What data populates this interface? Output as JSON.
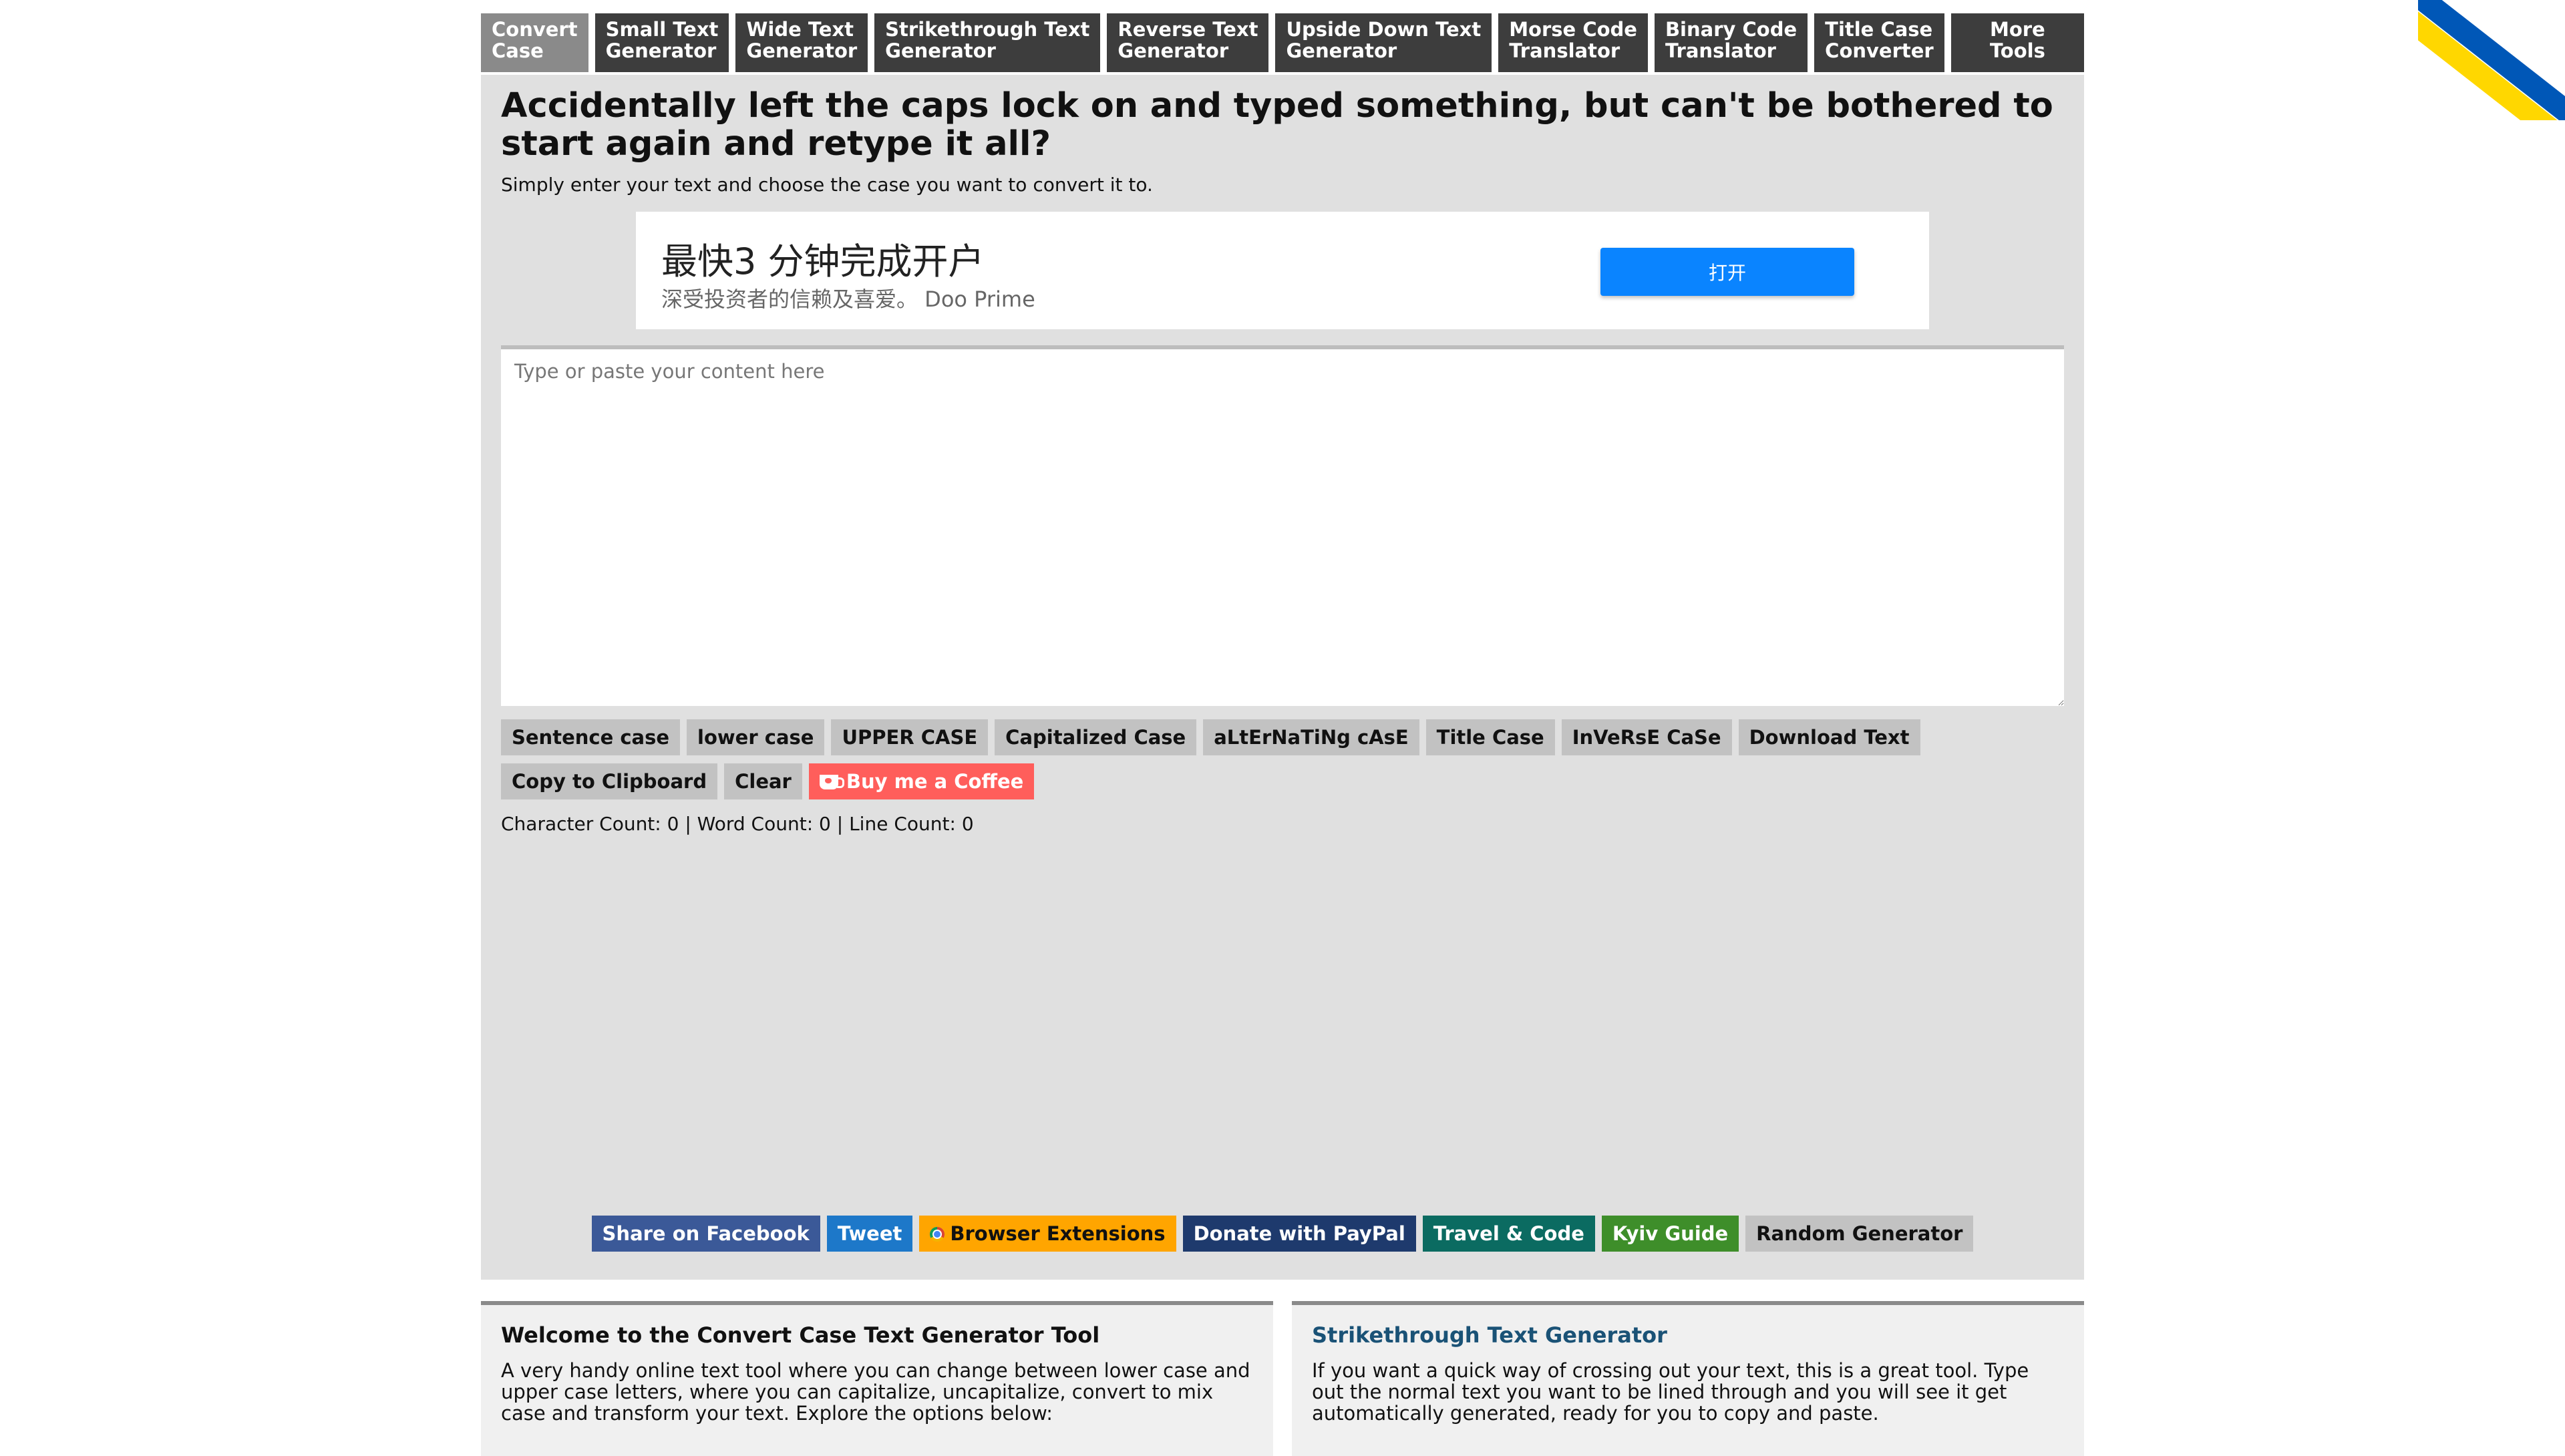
{
  "nav": [
    {
      "line1": "Convert",
      "line2": "Case",
      "active": true
    },
    {
      "line1": "Small Text",
      "line2": "Generator"
    },
    {
      "line1": "Wide Text",
      "line2": "Generator"
    },
    {
      "line1": "Strikethrough Text",
      "line2": "Generator"
    },
    {
      "line1": "Reverse Text",
      "line2": "Generator"
    },
    {
      "line1": "Upside Down Text",
      "line2": "Generator"
    },
    {
      "line1": "Morse Code",
      "line2": "Translator"
    },
    {
      "line1": "Binary Code",
      "line2": "Translator"
    },
    {
      "line1": "Title Case",
      "line2": "Converter"
    },
    {
      "line1": "More",
      "line2": "Tools"
    }
  ],
  "main": {
    "heading": "Accidentally left the caps lock on and typed something, but can't be bothered to start again and retype it all?",
    "subtitle": "Simply enter your text and choose the case you want to convert it to.",
    "textarea_placeholder": "Type or paste your content here",
    "counts": "Character Count: 0 | Word Count: 0 | Line Count: 0"
  },
  "ad": {
    "title": "最快3 分钟完成开户",
    "desc": "深受投资者的信赖及喜爱。 Doo Prime",
    "button": "打开"
  },
  "buttons": {
    "sentence": "Sentence case",
    "lower": "lower case",
    "upper": "UPPER CASE",
    "capitalized": "Capitalized Case",
    "alternating": "aLtErNaTiNg cAsE",
    "title": "Title Case",
    "inverse": "InVeRsE CaSe",
    "download": "Download Text",
    "copy": "Copy to Clipboard",
    "clear": "Clear",
    "coffee": "Buy me a Coffee"
  },
  "share": {
    "facebook": "Share on Facebook",
    "tweet": "Tweet",
    "extensions": "Browser Extensions",
    "paypal": "Donate with PayPal",
    "travel": "Travel & Code",
    "kyiv": "Kyiv Guide",
    "random": "Random Generator"
  },
  "cards": {
    "welcome": {
      "title": "Welcome to the Convert Case Text Generator Tool",
      "text": "A very handy online text tool where you can change between lower case and upper case letters, where you can capitalize, uncapitalize, convert to mix case and transform your text. Explore the options below:"
    },
    "strike": {
      "title": "Strikethrough Text Generator",
      "text": "If you want a quick way of crossing out your text, this is a great tool. Type out the normal text you want to be lined through and you will see it get automatically generated, ready for you to copy and paste."
    }
  },
  "colors": {
    "nav_bg": "#3d3d3d",
    "nav_active": "#8a8a8a",
    "panel_bg": "#e0e0e0",
    "ad_button": "#0a84ff",
    "coffee": "#ff5e5b",
    "facebook": "#3b5998",
    "tweet": "#1d78c9",
    "extensions": "#ffa500",
    "paypal": "#1e3a6d",
    "travel": "#0b6b61",
    "kyiv": "#3e8e2a",
    "ukraine_blue": "#0057b7",
    "ukraine_yellow": "#ffd700"
  },
  "icons": {
    "ribbon": "ukraine-flag-ribbon",
    "coffee": "coffee-cup-icon",
    "extensions": "chrome-icon"
  }
}
